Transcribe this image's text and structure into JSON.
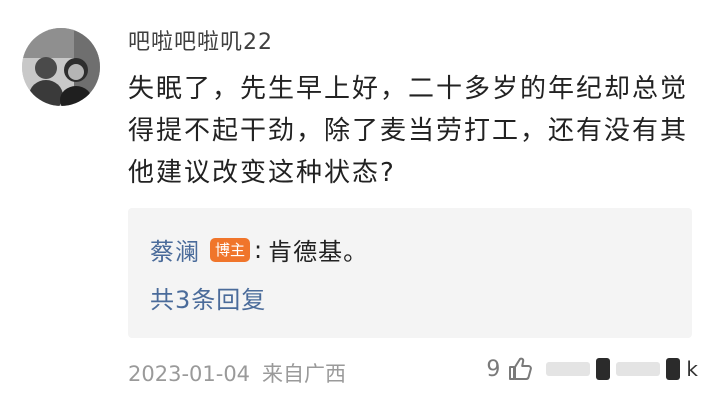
{
  "comment": {
    "username": "吧啦吧啦叽22",
    "text": "失眠了，先生早上好，二十多岁的年纪却总觉得提不起干劲，除了麦当劳打工，还有没有其他建议改变这种状态?",
    "date": "2023-01-04",
    "source": "来自广西",
    "like_count": "9"
  },
  "reply": {
    "author": "蔡澜",
    "badge": "博主",
    "separator": ":",
    "content": "肯德基。",
    "reply_count_label": "共3条回复"
  },
  "watermark": {
    "suffix": "k"
  },
  "colors": {
    "link": "#4a6b9a",
    "badge": "#f0752b",
    "reply_bg": "#f4f4f4",
    "meta": "#9a9a9a"
  },
  "icons": {
    "like": "thumbs-up-icon",
    "avatar": "user-avatar"
  }
}
